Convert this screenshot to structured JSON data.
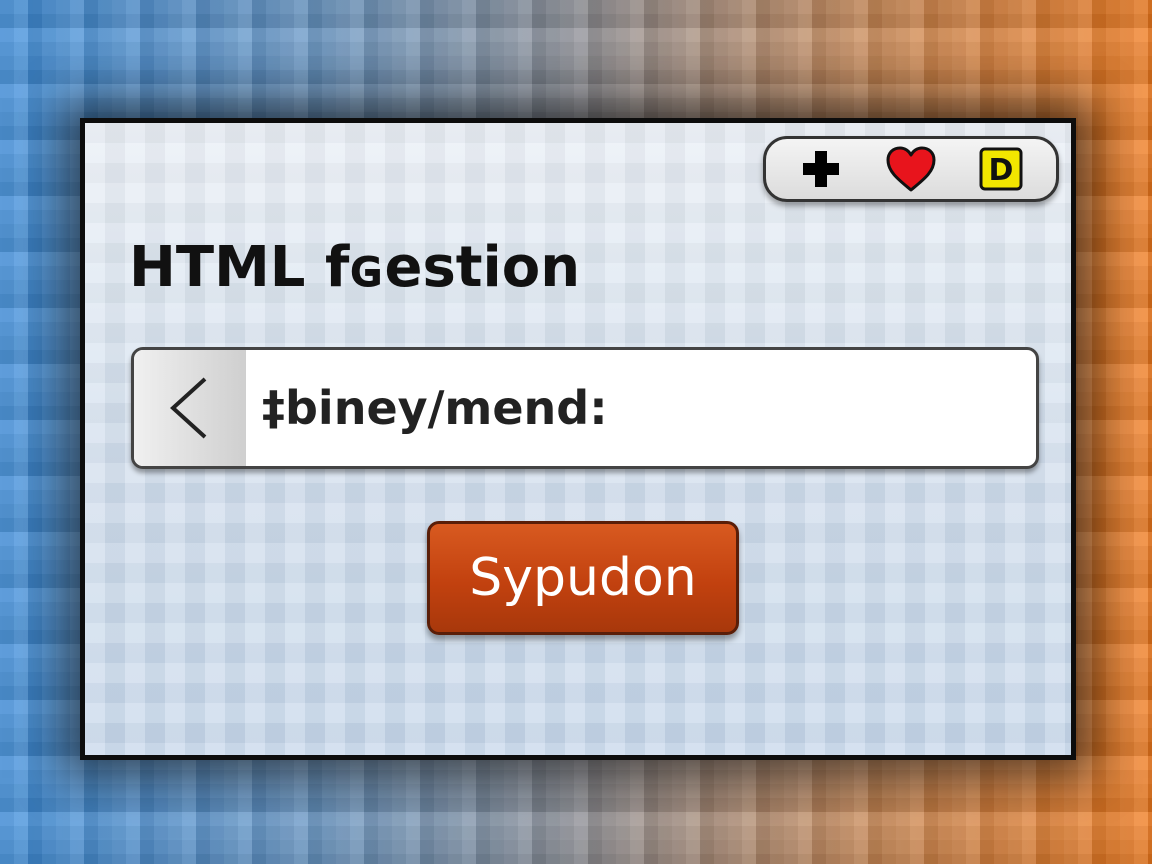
{
  "page": {
    "title": "HTML fɢestion"
  },
  "toolbar": {
    "icons": [
      "plus-icon",
      "heart-icon",
      "d-badge-icon"
    ],
    "badge_letter": "D",
    "colors": {
      "heart": "#e8141c",
      "badge": "#f2e600"
    }
  },
  "address_bar": {
    "back_icon": "chevron-left-icon",
    "value": "‡biney/mend:"
  },
  "submit": {
    "label": "Sypudon",
    "color": "#c2410f"
  },
  "colors": {
    "background_left": "#3f8fdc",
    "background_right": "#ef7a1e"
  }
}
